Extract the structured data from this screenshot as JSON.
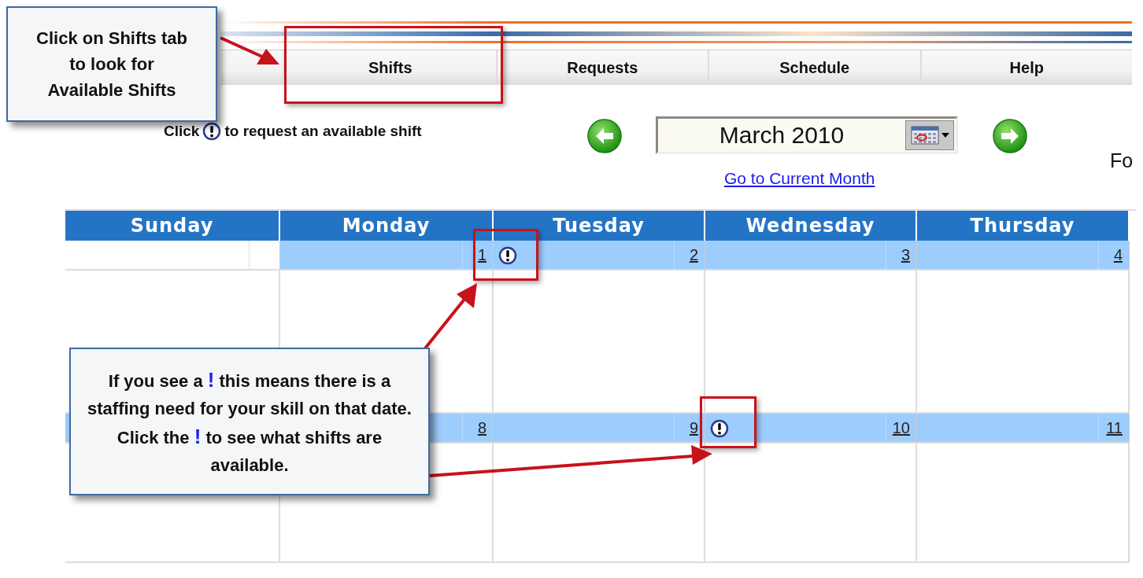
{
  "tabs": [
    {
      "label": "Shifts"
    },
    {
      "label": "Requests"
    },
    {
      "label": "Schedule"
    },
    {
      "label": "Help"
    }
  ],
  "hint": {
    "before": "Click",
    "after": "to request an available shift"
  },
  "month_picker": {
    "value": "March 2010"
  },
  "current_month_link": "Go to Current Month",
  "cut_text": "Fo",
  "calendar": {
    "columns": [
      "Sunday",
      "Monday",
      "Tuesday",
      "Wednesday",
      "Thursday"
    ],
    "weeks": [
      {
        "days": [
          {
            "in_month": false,
            "alert": false
          },
          {
            "in_month": true,
            "date": "1",
            "alert": false
          },
          {
            "in_month": true,
            "date": "2",
            "alert": true
          },
          {
            "in_month": true,
            "date": "3",
            "alert": false
          },
          {
            "in_month": true,
            "date": "4",
            "alert": false
          }
        ]
      },
      {
        "days": [
          {
            "in_month": true,
            "alert": false
          },
          {
            "in_month": true,
            "date": "8",
            "alert": false
          },
          {
            "in_month": true,
            "date": "9",
            "alert": false
          },
          {
            "in_month": true,
            "date": "10",
            "alert": true
          },
          {
            "in_month": true,
            "date": "11",
            "alert": false
          }
        ]
      }
    ]
  },
  "callouts": [
    {
      "text": "Click on Shifts tab to look for Available Shifts"
    },
    {
      "text": "If you see a **!** this means there is a staffing need for your skill on that date. Click the **!** to see what shifts are available."
    }
  ]
}
